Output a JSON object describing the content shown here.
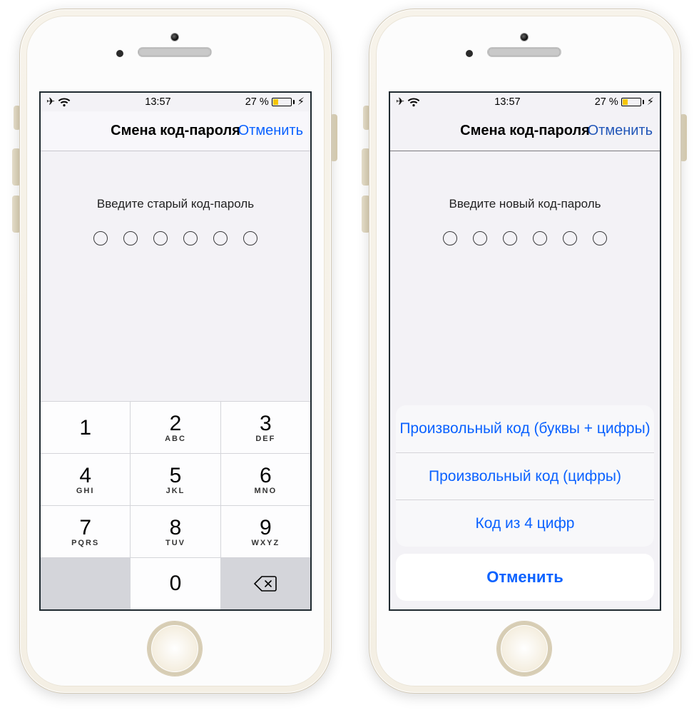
{
  "status": {
    "time": "13:57",
    "battery_text": "27 %",
    "charging_glyph": "⚡︎"
  },
  "nav": {
    "title": "Смена код-пароля",
    "cancel": "Отменить"
  },
  "screen1": {
    "prompt": "Введите старый код-пароль"
  },
  "screen2": {
    "prompt": "Введите новый код-пароль"
  },
  "keypad": {
    "k1": {
      "num": "1",
      "sub": ""
    },
    "k2": {
      "num": "2",
      "sub": "ABC"
    },
    "k3": {
      "num": "3",
      "sub": "DEF"
    },
    "k4": {
      "num": "4",
      "sub": "GHI"
    },
    "k5": {
      "num": "5",
      "sub": "JKL"
    },
    "k6": {
      "num": "6",
      "sub": "MNO"
    },
    "k7": {
      "num": "7",
      "sub": "PQRS"
    },
    "k8": {
      "num": "8",
      "sub": "TUV"
    },
    "k9": {
      "num": "9",
      "sub": "WXYZ"
    },
    "k0": {
      "num": "0",
      "sub": ""
    }
  },
  "sheet": {
    "opt1": "Произвольный код (буквы + цифры)",
    "opt2": "Произвольный код (цифры)",
    "opt3": "Код из 4 цифр",
    "cancel": "Отменить"
  }
}
